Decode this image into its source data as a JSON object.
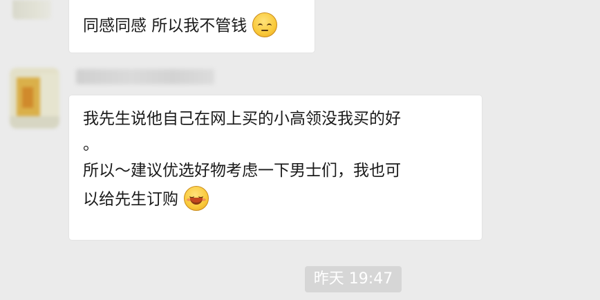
{
  "messages": [
    {
      "text": "同感同感 所以我不管钱",
      "emoji": "pensive-face-icon"
    },
    {
      "lines": [
        "我先生说他自己在网上买的小高领没我买的好",
        "。",
        "所以～建议优选好物考虑一下男士们，我也可",
        "以给先生订购"
      ],
      "emoji": "smiling-face-icon"
    }
  ],
  "timestamp": "昨天 19:47",
  "colors": {
    "background": "#ebebeb",
    "bubble": "#ffffff",
    "timestamp_bg": "#d6d6d6",
    "emoji_yellow": "#f9c93a"
  }
}
